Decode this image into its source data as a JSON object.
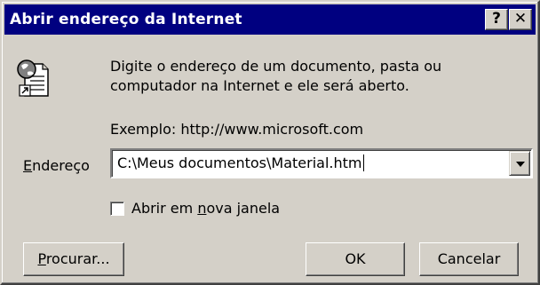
{
  "window": {
    "title": "Abrir endereço da Internet",
    "help_label": "?",
    "close_label": "✕"
  },
  "dialog": {
    "description_line1": "Digite o endereço de um documento, pasta ou",
    "description_line2": "computador na Internet e ele será aberto.",
    "example": "Exemplo: http://www.microsoft.com",
    "address_label_first": "E",
    "address_label_rest": "ndereço",
    "address_value": "C:\\Meus documentos\\Material.htm",
    "checkbox_checked": false,
    "checkbox_label_pre": "Abrir em ",
    "checkbox_label_mnemonic": "n",
    "checkbox_label_post": "ova janela"
  },
  "buttons": {
    "browse_mnemonic": "P",
    "browse_rest": "rocurar...",
    "ok": "OK",
    "cancel": "Cancelar"
  },
  "colors": {
    "titlebar": "#000080",
    "face": "#d4d0c8"
  }
}
